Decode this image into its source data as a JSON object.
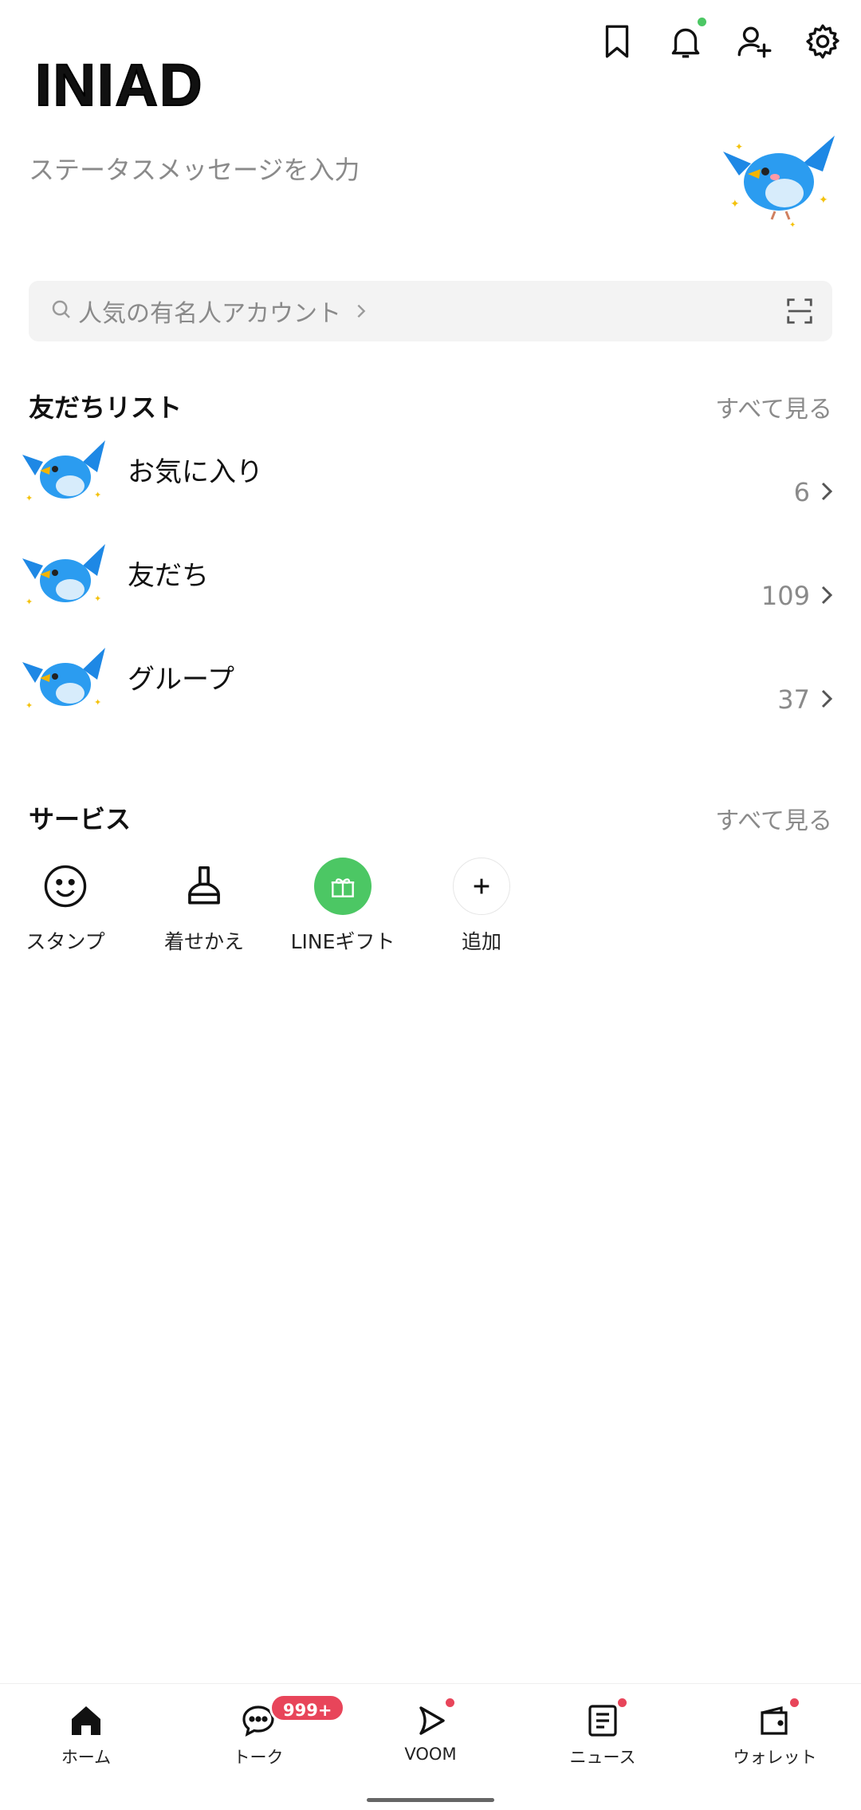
{
  "profile": {
    "name": "INIAD",
    "status_placeholder": "ステータスメッセージを入力"
  },
  "search": {
    "placeholder": "人気の有名人アカウント"
  },
  "friend_list": {
    "title": "友だちリスト",
    "see_all": "すべて見る",
    "rows": [
      {
        "label": "お気に入り",
        "count": "6"
      },
      {
        "label": "友だち",
        "count": "109"
      },
      {
        "label": "グループ",
        "count": "37"
      }
    ]
  },
  "services": {
    "title": "サービス",
    "see_all": "すべて見る",
    "items": [
      {
        "label": "スタンプ",
        "icon": "smiley-icon"
      },
      {
        "label": "着せかえ",
        "icon": "brush-icon"
      },
      {
        "label": "LINEギフト",
        "icon": "gift-icon"
      },
      {
        "label": "追加",
        "icon": "plus-icon"
      }
    ]
  },
  "nav": {
    "items": [
      {
        "label": "ホーム",
        "icon": "home-icon"
      },
      {
        "label": "トーク",
        "icon": "chat-icon",
        "badge": "999+"
      },
      {
        "label": "VOOM",
        "icon": "voom-icon"
      },
      {
        "label": "ニュース",
        "icon": "news-icon"
      },
      {
        "label": "ウォレット",
        "icon": "wallet-icon"
      }
    ]
  },
  "colors": {
    "accent_green": "#4cc764",
    "notification_dot_green": "#4cc764",
    "badge_red": "#e8455a",
    "secondary_text": "#8a8a8a",
    "search_bg": "#f3f3f3"
  }
}
